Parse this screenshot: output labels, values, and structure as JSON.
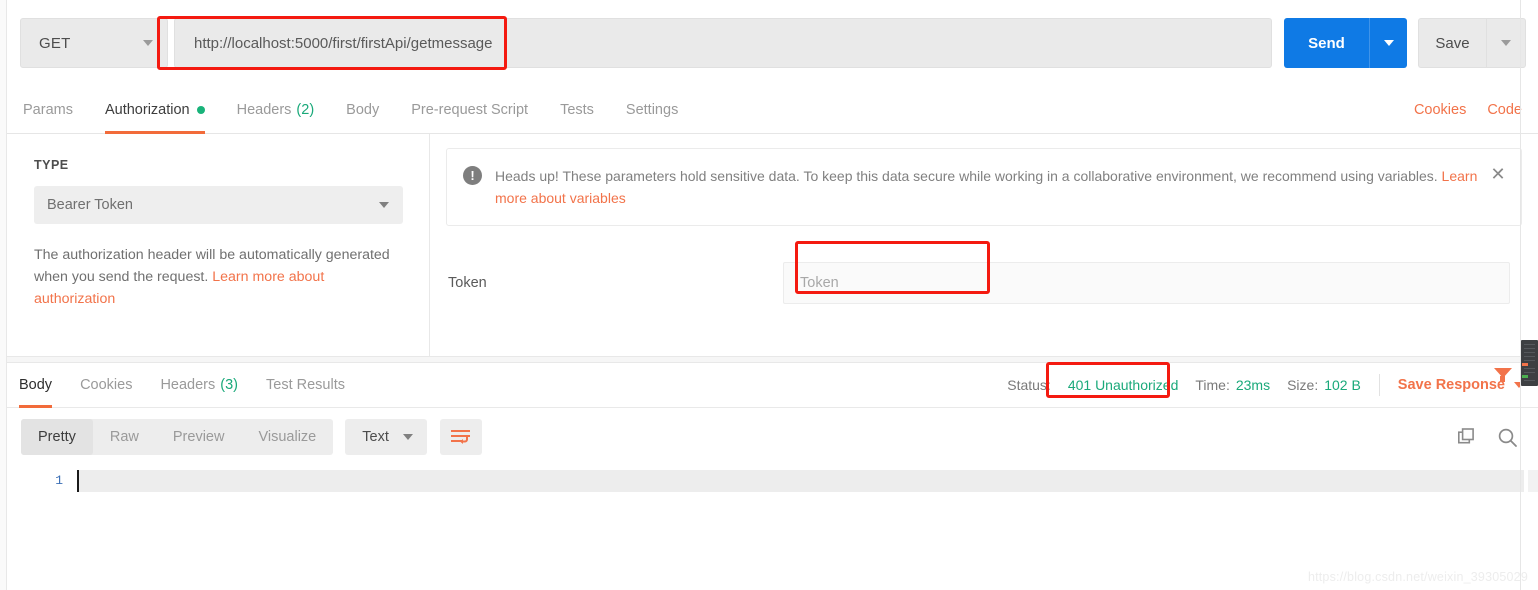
{
  "request": {
    "method": "GET",
    "url": "http://localhost:5000/first/firstApi/getmessage",
    "send_label": "Send",
    "save_label": "Save"
  },
  "request_tabs": [
    {
      "label": "Params",
      "active": false,
      "badge": "",
      "dot": false
    },
    {
      "label": "Authorization",
      "active": true,
      "badge": "",
      "dot": true
    },
    {
      "label": "Headers",
      "active": false,
      "badge": "(2)",
      "dot": false
    },
    {
      "label": "Body",
      "active": false,
      "badge": "",
      "dot": false
    },
    {
      "label": "Pre-request Script",
      "active": false,
      "badge": "",
      "dot": false
    },
    {
      "label": "Tests",
      "active": false,
      "badge": "",
      "dot": false
    },
    {
      "label": "Settings",
      "active": false,
      "badge": "",
      "dot": false
    }
  ],
  "tabs_right": {
    "cookies": "Cookies",
    "code": "Code"
  },
  "auth": {
    "type_label": "TYPE",
    "type_value": "Bearer Token",
    "description_text": "The authorization header will be automatically generated when you send the request. ",
    "description_link": "Learn more about authorization",
    "notice_text": "Heads up! These parameters hold sensitive data. To keep this data secure while working in a collaborative environment, we recommend using variables. ",
    "notice_link": "Learn more about variables",
    "notice_close": "✕",
    "warn_glyph": "!",
    "token_label": "Token",
    "token_value": "",
    "token_placeholder": "Token"
  },
  "response_tabs": [
    {
      "label": "Body",
      "active": true,
      "badge": ""
    },
    {
      "label": "Cookies",
      "active": false,
      "badge": ""
    },
    {
      "label": "Headers",
      "active": false,
      "badge": "(3)"
    },
    {
      "label": "Test Results",
      "active": false,
      "badge": ""
    }
  ],
  "status": {
    "status_label": "Status:",
    "status_value": "401 Unauthorized",
    "time_label": "Time:",
    "time_value": "23ms",
    "size_label": "Size:",
    "size_value": "102 B",
    "save_response": "Save Response"
  },
  "view_toolbar": {
    "modes": [
      {
        "label": "Pretty",
        "active": true
      },
      {
        "label": "Raw",
        "active": false
      },
      {
        "label": "Preview",
        "active": false
      },
      {
        "label": "Visualize",
        "active": false
      }
    ],
    "format": "Text",
    "wrap_icon": "wrap-lines-icon",
    "copy_icon": "copy-icon",
    "search_icon": "search-icon"
  },
  "editor": {
    "line_number": "1",
    "line_content": ""
  },
  "watermark": "https://blog.csdn.net/weixin_39305029",
  "colors": {
    "accent_orange": "#f2734a",
    "send_blue": "#0f7ae5",
    "status_green": "#1aa97a",
    "annotation_red": "#f41a10"
  }
}
